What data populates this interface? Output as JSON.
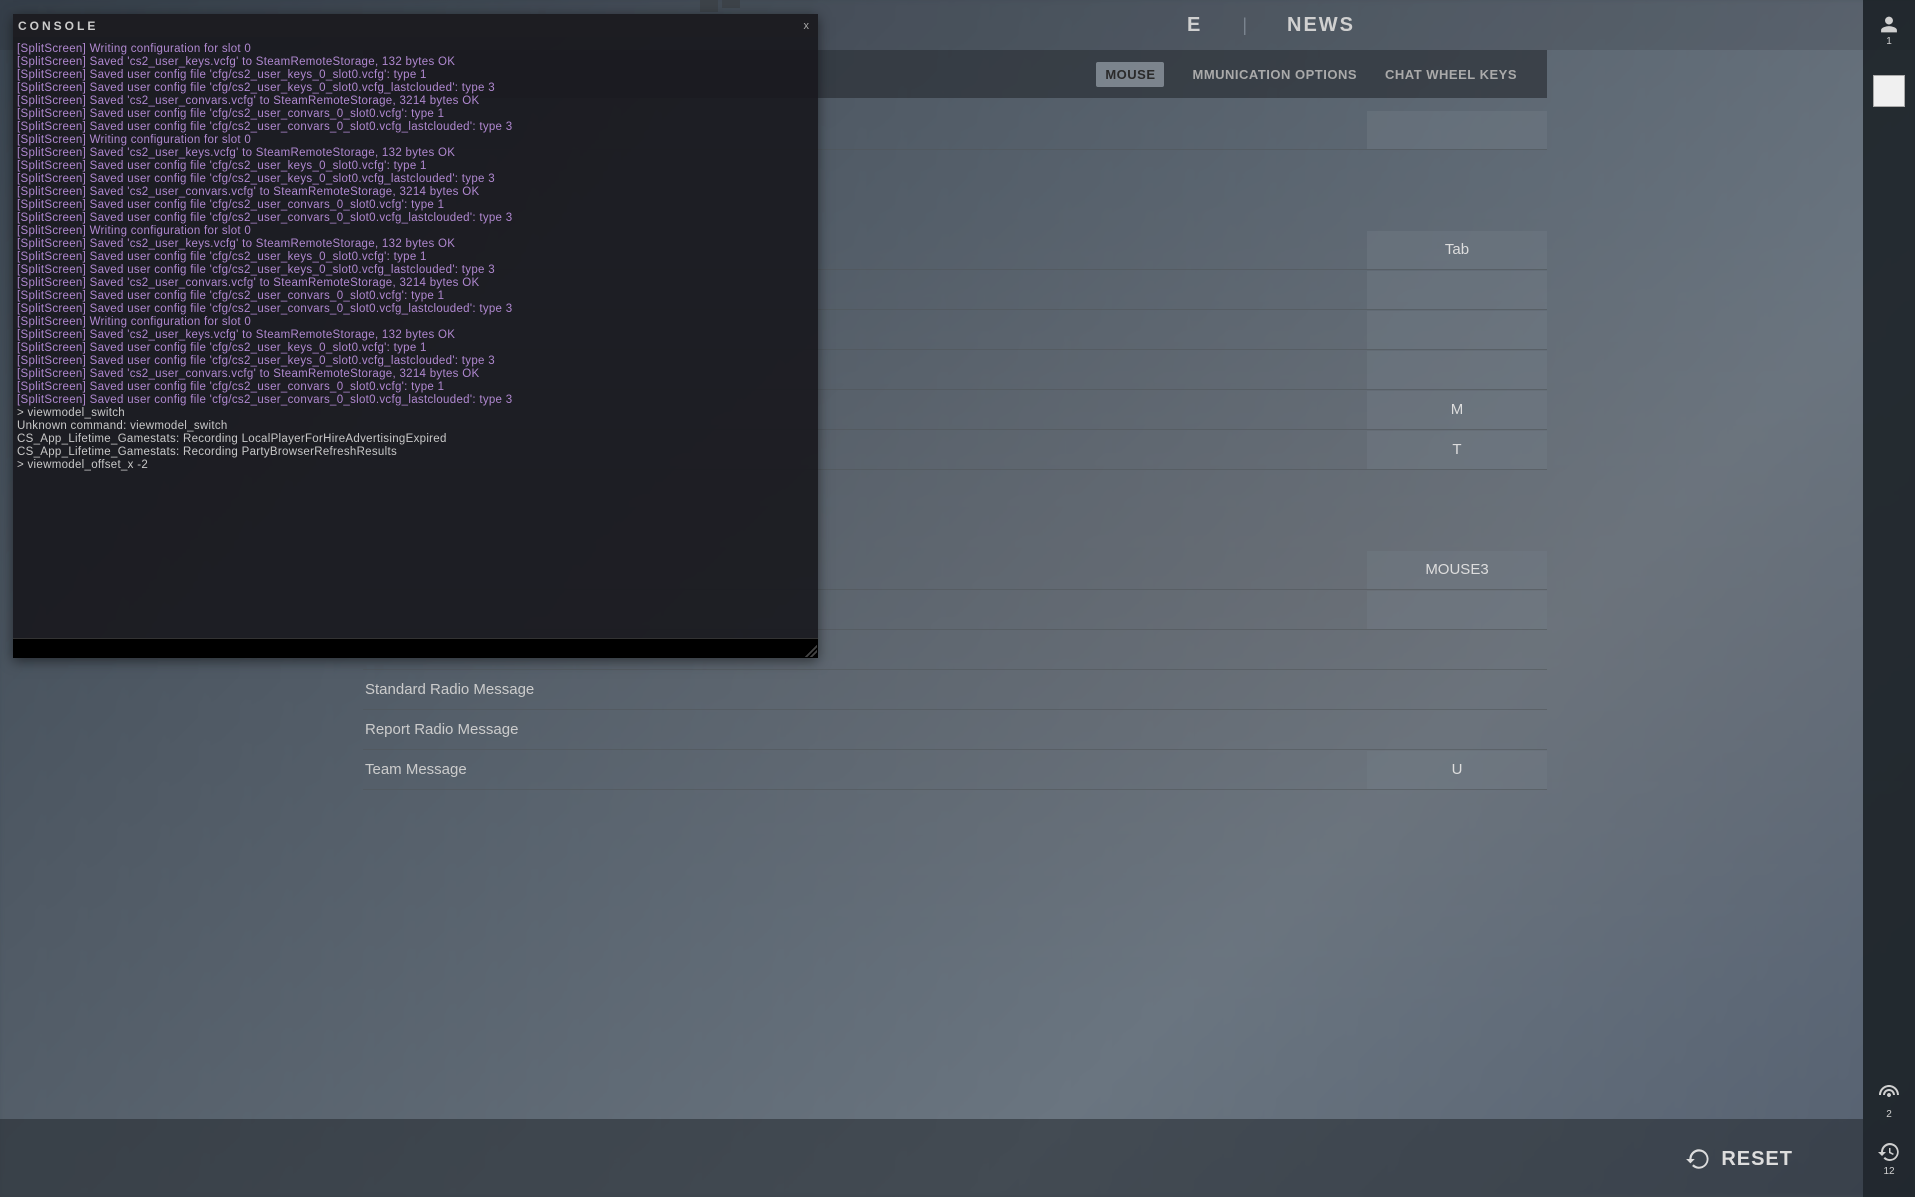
{
  "topnav": {
    "store_partial": "E",
    "news": "NEWS"
  },
  "profile": {
    "count": "1"
  },
  "right_bottom": {
    "wifi_count": "2",
    "history_count": "12"
  },
  "subtabs": {
    "keyboard_mouse_partial": "MOUSE",
    "comm_options": "MMUNICATION OPTIONS",
    "chat_wheel": "CHAT WHEEL KEYS"
  },
  "bindings": [
    {
      "label": "",
      "value": "",
      "blank": true
    },
    {
      "label": "",
      "value": "",
      "spacer": true
    },
    {
      "label": "",
      "value": "",
      "spacer": true
    },
    {
      "label": "",
      "value": "Tab"
    },
    {
      "label": "",
      "value": "",
      "blank": true
    },
    {
      "label": "",
      "value": "",
      "blank": true
    },
    {
      "label": "",
      "value": "",
      "blank": true
    },
    {
      "label": "",
      "value": "M"
    },
    {
      "label": "",
      "value": "T"
    },
    {
      "label": "",
      "value": "",
      "spacer": true
    },
    {
      "label": "",
      "value": "",
      "spacer": true
    },
    {
      "label": "",
      "value": "MOUSE3"
    },
    {
      "label": "",
      "value": "",
      "blank": true
    },
    {
      "label": "",
      "value": "",
      "novalue": true
    },
    {
      "label": "Standard Radio Message",
      "value": "",
      "novalue": true
    },
    {
      "label": "Report Radio Message",
      "value": "",
      "novalue": true
    },
    {
      "label": "Team Message",
      "value": "U"
    }
  ],
  "reset": "RESET",
  "console": {
    "title": "CONSOLE",
    "close": "x",
    "lines": [
      {
        "c": "purple",
        "t": "[SplitScreen] Writing configuration for slot 0"
      },
      {
        "c": "purple",
        "t": "[SplitScreen] Saved 'cs2_user_keys.vcfg' to SteamRemoteStorage, 132 bytes OK"
      },
      {
        "c": "purple",
        "t": "[SplitScreen] Saved user config file 'cfg/cs2_user_keys_0_slot0.vcfg': type 1"
      },
      {
        "c": "purple",
        "t": "[SplitScreen] Saved user config file 'cfg/cs2_user_keys_0_slot0.vcfg_lastclouded': type 3"
      },
      {
        "c": "purple",
        "t": "[SplitScreen] Saved 'cs2_user_convars.vcfg' to SteamRemoteStorage, 3214 bytes OK"
      },
      {
        "c": "purple",
        "t": "[SplitScreen] Saved user config file 'cfg/cs2_user_convars_0_slot0.vcfg': type 1"
      },
      {
        "c": "purple",
        "t": "[SplitScreen] Saved user config file 'cfg/cs2_user_convars_0_slot0.vcfg_lastclouded': type 3"
      },
      {
        "c": "purple",
        "t": "[SplitScreen] Writing configuration for slot 0"
      },
      {
        "c": "purple",
        "t": "[SplitScreen] Saved 'cs2_user_keys.vcfg' to SteamRemoteStorage, 132 bytes OK"
      },
      {
        "c": "purple",
        "t": "[SplitScreen] Saved user config file 'cfg/cs2_user_keys_0_slot0.vcfg': type 1"
      },
      {
        "c": "purple",
        "t": "[SplitScreen] Saved user config file 'cfg/cs2_user_keys_0_slot0.vcfg_lastclouded': type 3"
      },
      {
        "c": "purple",
        "t": "[SplitScreen] Saved 'cs2_user_convars.vcfg' to SteamRemoteStorage, 3214 bytes OK"
      },
      {
        "c": "purple",
        "t": "[SplitScreen] Saved user config file 'cfg/cs2_user_convars_0_slot0.vcfg': type 1"
      },
      {
        "c": "purple",
        "t": "[SplitScreen] Saved user config file 'cfg/cs2_user_convars_0_slot0.vcfg_lastclouded': type 3"
      },
      {
        "c": "purple",
        "t": "[SplitScreen] Writing configuration for slot 0"
      },
      {
        "c": "purple",
        "t": "[SplitScreen] Saved 'cs2_user_keys.vcfg' to SteamRemoteStorage, 132 bytes OK"
      },
      {
        "c": "purple",
        "t": "[SplitScreen] Saved user config file 'cfg/cs2_user_keys_0_slot0.vcfg': type 1"
      },
      {
        "c": "purple",
        "t": "[SplitScreen] Saved user config file 'cfg/cs2_user_keys_0_slot0.vcfg_lastclouded': type 3"
      },
      {
        "c": "purple",
        "t": "[SplitScreen] Saved 'cs2_user_convars.vcfg' to SteamRemoteStorage, 3214 bytes OK"
      },
      {
        "c": "purple",
        "t": "[SplitScreen] Saved user config file 'cfg/cs2_user_convars_0_slot0.vcfg': type 1"
      },
      {
        "c": "purple",
        "t": "[SplitScreen] Saved user config file 'cfg/cs2_user_convars_0_slot0.vcfg_lastclouded': type 3"
      },
      {
        "c": "purple",
        "t": "[SplitScreen] Writing configuration for slot 0"
      },
      {
        "c": "purple",
        "t": "[SplitScreen] Saved 'cs2_user_keys.vcfg' to SteamRemoteStorage, 132 bytes OK"
      },
      {
        "c": "purple",
        "t": "[SplitScreen] Saved user config file 'cfg/cs2_user_keys_0_slot0.vcfg': type 1"
      },
      {
        "c": "purple",
        "t": "[SplitScreen] Saved user config file 'cfg/cs2_user_keys_0_slot0.vcfg_lastclouded': type 3"
      },
      {
        "c": "purple",
        "t": "[SplitScreen] Saved 'cs2_user_convars.vcfg' to SteamRemoteStorage, 3214 bytes OK"
      },
      {
        "c": "purple",
        "t": "[SplitScreen] Saved user config file 'cfg/cs2_user_convars_0_slot0.vcfg': type 1"
      },
      {
        "c": "purple",
        "t": "[SplitScreen] Saved user config file 'cfg/cs2_user_convars_0_slot0.vcfg_lastclouded': type 3"
      },
      {
        "c": "white",
        "t": "> viewmodel_switch"
      },
      {
        "c": "white",
        "t": "Unknown command: viewmodel_switch"
      },
      {
        "c": "white",
        "t": "CS_App_Lifetime_Gamestats: Recording LocalPlayerForHireAdvertisingExpired"
      },
      {
        "c": "white",
        "t": "CS_App_Lifetime_Gamestats: Recording PartyBrowserRefreshResults"
      },
      {
        "c": "white",
        "t": "> viewmodel_offset_x -2"
      }
    ]
  }
}
